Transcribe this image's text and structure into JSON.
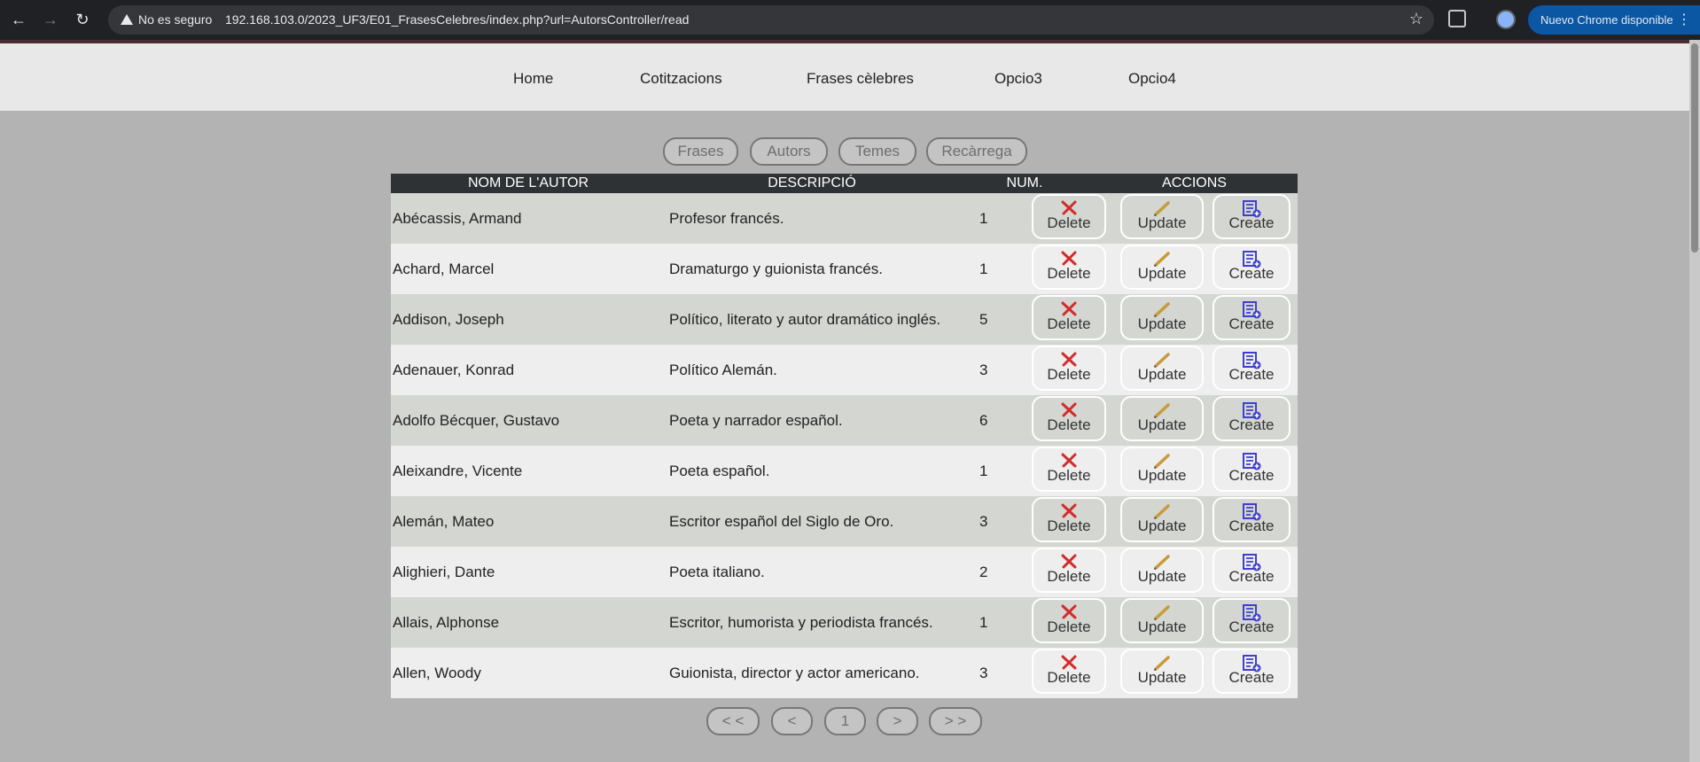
{
  "browser": {
    "security_label": "No es seguro",
    "url": "192.168.103.0/2023_UF3/E01_FrasesCelebres/index.php?url=AutorsController/read",
    "update_label": "Nuevo Chrome disponible"
  },
  "nav": {
    "items": [
      "Home",
      "Cotitzacions",
      "Frases cèlebres",
      "Opcio3",
      "Opcio4"
    ]
  },
  "subnav": {
    "items": [
      "Frases",
      "Autors",
      "Temes",
      "Recàrrega"
    ]
  },
  "table": {
    "headers": [
      "Nom de l'autor",
      "Descripció",
      "Num.",
      "Accions"
    ],
    "rows": [
      {
        "name": "Abécassis, Armand",
        "desc": "Profesor francés.",
        "num": "1"
      },
      {
        "name": "Achard, Marcel",
        "desc": "Dramaturgo y guionista francés.",
        "num": "1"
      },
      {
        "name": "Addison, Joseph",
        "desc": "Político, literato y autor dramático inglés.",
        "num": "5"
      },
      {
        "name": "Adenauer, Konrad",
        "desc": "Político Alemán.",
        "num": "3"
      },
      {
        "name": "Adolfo Bécquer, Gustavo",
        "desc": "Poeta y narrador español.",
        "num": "6"
      },
      {
        "name": "Aleixandre, Vicente",
        "desc": "Poeta español.",
        "num": "1"
      },
      {
        "name": "Alemán, Mateo",
        "desc": "Escritor español del Siglo de Oro.",
        "num": "3"
      },
      {
        "name": "Alighieri, Dante",
        "desc": "Poeta italiano.",
        "num": "2"
      },
      {
        "name": "Allais, Alphonse",
        "desc": "Escritor, humorista y periodista francés.",
        "num": "1"
      },
      {
        "name": "Allen, Woody",
        "desc": "Guionista, director y actor americano.",
        "num": "3"
      }
    ],
    "actions": {
      "delete": "Delete",
      "update": "Update",
      "create": "Create"
    }
  },
  "pagination": {
    "first": "< <",
    "prev": "<",
    "current": "1",
    "next": ">",
    "last": "> >"
  },
  "icons": {
    "delete": "x-mark-icon",
    "update": "pencil-icon",
    "create": "list-add-icon"
  },
  "colors": {
    "delete_icon": "#d22b2b",
    "update_icon": "#c89a3a",
    "create_icon": "#3f3fcf",
    "table_header": "#2f3234"
  }
}
